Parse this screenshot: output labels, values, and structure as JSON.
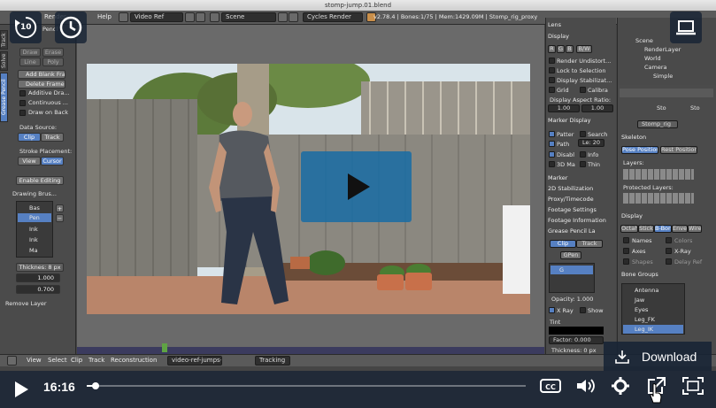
{
  "window": {
    "title": "stomp-jump.01.blend"
  },
  "header": {
    "menu_help": "Help",
    "screen": "Video Ref",
    "scene": "Scene",
    "engine": "Cycles Render",
    "stats": "v2.78.4 | Bones:1/75 | Mem:1429.09M | Stomp_rig_proxy"
  },
  "left_shelf": {
    "tabs": [
      "Track",
      "Solve",
      "Grease Pencil"
    ],
    "draw_labels": [
      "Draw",
      "Erase",
      "Line",
      "Poly"
    ],
    "add_blank": "Add Blank Fra...",
    "delete_frames": "Delete Frame(s)",
    "options": [
      "Additive Dra...",
      "Continuous ...",
      "Draw on Back"
    ],
    "data_source_label": "Data Source:",
    "data_source_options": [
      "Clip",
      "Track"
    ],
    "stroke_placement_label": "Stroke Placement:",
    "stroke_placement_options": [
      "View",
      "Cursor"
    ],
    "enable_editing": "Enable Editing",
    "drawing_brushes_title": "Drawing Brus...",
    "brushes": [
      "Bas",
      "Pen",
      "Ink",
      "Ink",
      "Ma"
    ],
    "thickness_label": "Thicknes: 8 px",
    "value_1": "1.000",
    "value_2": "0.700",
    "remove_layer": "Remove Layer",
    "top_label": "Pencl"
  },
  "clip_header": {
    "menus": [
      "View",
      "Select",
      "Clip",
      "Track",
      "Reconstruction"
    ],
    "clip_name": "video-ref-jumps-24...",
    "mode": "Tracking"
  },
  "right_panel": {
    "lens": "Lens",
    "display": "Display",
    "channel_buttons": [
      "R",
      "G",
      "B",
      "B/W"
    ],
    "display_options": [
      "Render Undistort...",
      "Lock to Selection",
      "Display Stabilizat...",
      "Grid",
      "Calibra"
    ],
    "aspect_label": "Display Aspect Ratio:",
    "aspect_x": "1.00",
    "aspect_y": "1.00",
    "marker_display": "Marker Display",
    "marker_options": [
      "Patter",
      "Search",
      "Path",
      "Le: 20",
      "Disabl",
      "Info",
      "3D Ma",
      "Thin"
    ],
    "sections": [
      "Marker",
      "2D Stabilization",
      "Proxy/Timecode",
      "Footage Settings",
      "Footage Information",
      "Grease Pencil La"
    ],
    "gp_source": [
      "Clip",
      "Track"
    ],
    "gp_layer": "GPen",
    "gp_layer_item": "G",
    "opacity": "Opacity:  1.000",
    "xray": "X Ray",
    "show": "Show",
    "tint": "Tint",
    "factor": "Factor:   0.000",
    "thickness": "Thickness: 0 px"
  },
  "outliner": {
    "items": [
      "Scene",
      "RenderLayer",
      "World",
      "Camera",
      "Simple"
    ]
  },
  "properties": {
    "object_name": "Sto",
    "object_name2": "Sto",
    "rig_name": "Stomp_rig",
    "skeleton": "Skeleton",
    "pose_position": "Pose Position",
    "rest_position": "Rest Position",
    "layers_label": "Layers:",
    "protected_label": "Protected Layers:",
    "display": "Display",
    "display_modes": [
      "Octah",
      "Stick",
      "B-Bon",
      "Envel",
      "Wire"
    ],
    "display_options": [
      "Names",
      "Colors",
      "Axes",
      "X-Ray",
      "Shapes",
      "Delay Ref"
    ],
    "bone_groups": "Bone Groups",
    "bone_group_items": [
      "Antenna",
      "Jaw",
      "Eyes",
      "Leg_FK",
      "Leg_IK"
    ]
  },
  "player": {
    "time": "16:16",
    "progress": 0.02,
    "skip_back_seconds": "10",
    "download_label": "Download"
  },
  "colors": {
    "accent": "#186ca5",
    "player_bg": "#172334",
    "blender_blue": "#5680c2"
  }
}
